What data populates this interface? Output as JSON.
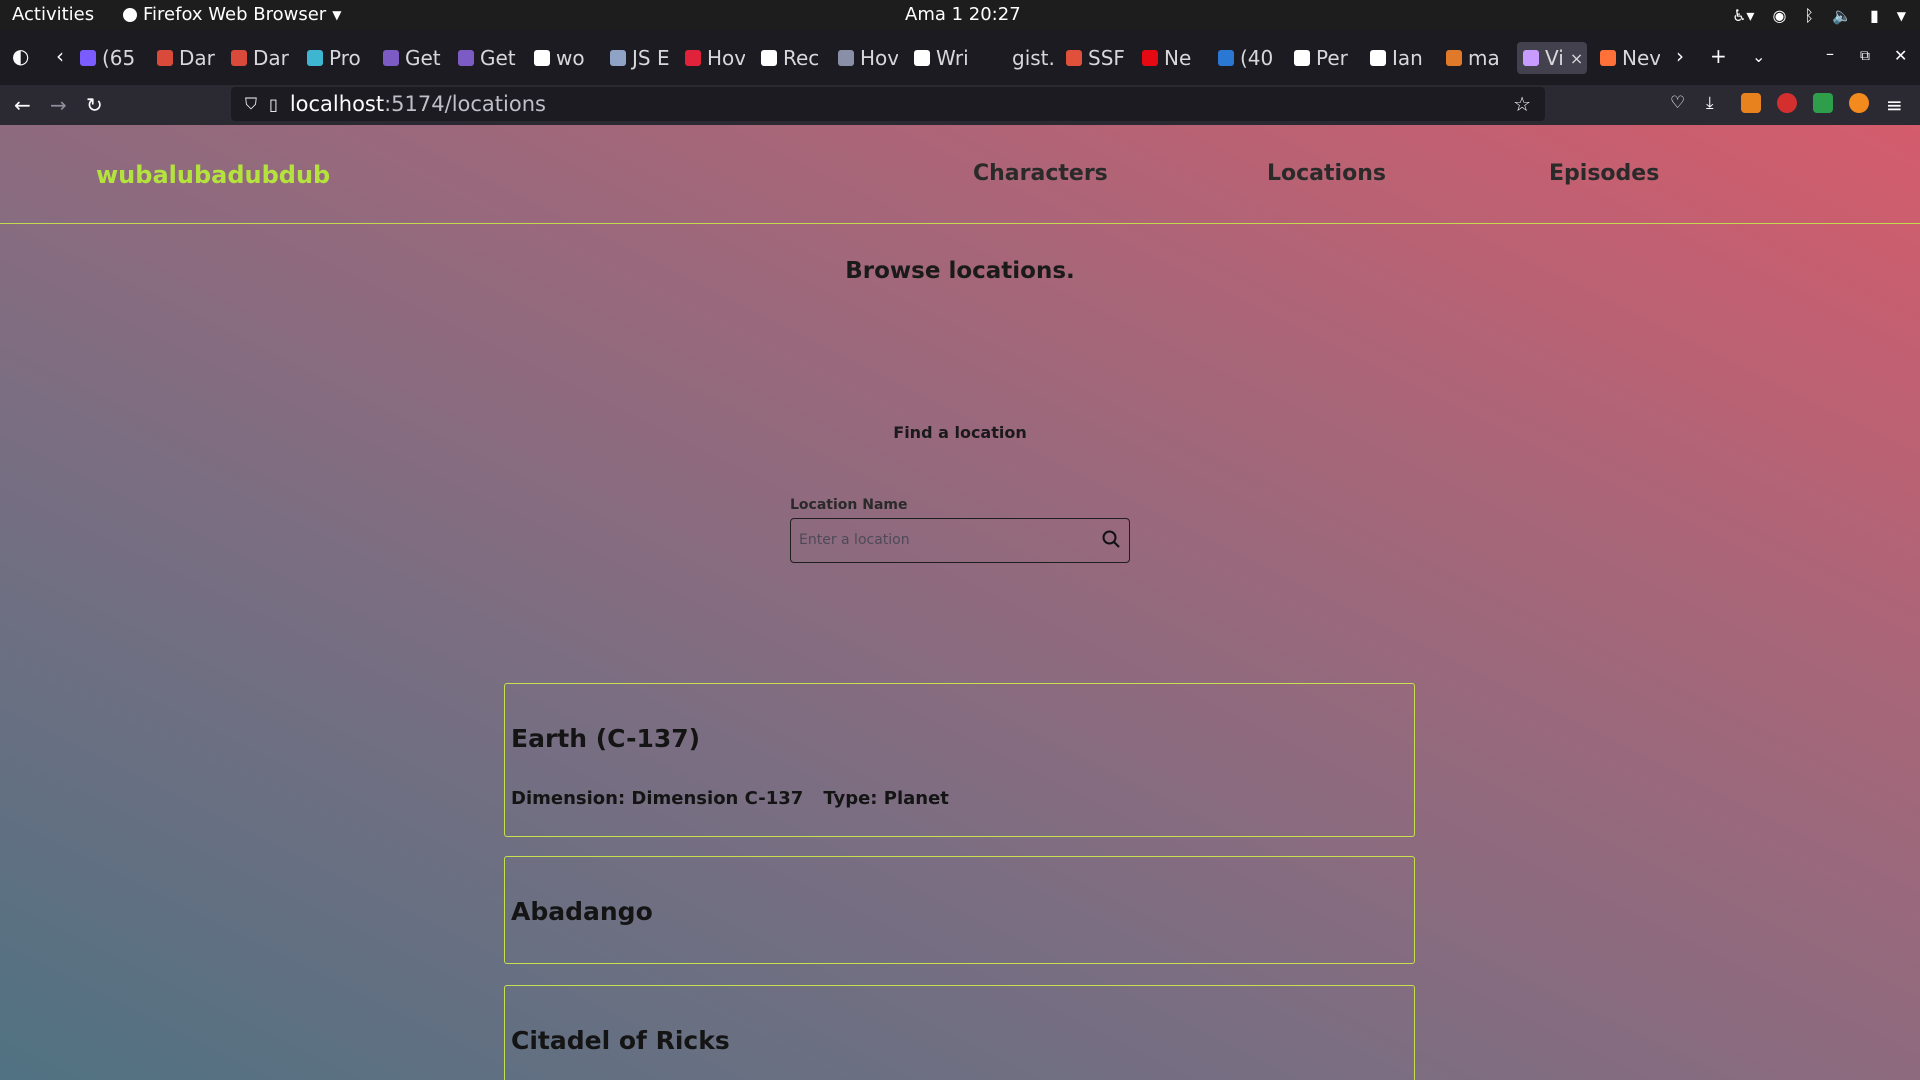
{
  "system": {
    "activities": "Activities",
    "app_menu": "Firefox Web Browser",
    "clock": "Ama 1  20:27"
  },
  "browser": {
    "tabs": [
      {
        "label": "(65",
        "color": "#7b5cff"
      },
      {
        "label": "Dar",
        "color": "#d94a3a"
      },
      {
        "label": "Dar",
        "color": "#d94a3a"
      },
      {
        "label": "Pro",
        "color": "#3fb6d1"
      },
      {
        "label": "Get",
        "color": "#7c5cc4"
      },
      {
        "label": "Get",
        "color": "#7c5cc4"
      },
      {
        "label": "wo",
        "color": "#ffffff"
      },
      {
        "label": "JS E",
        "color": "#8fa3c7"
      },
      {
        "label": "Hov",
        "color": "#e0223a"
      },
      {
        "label": "Rec",
        "color": "#ffffff"
      },
      {
        "label": "Hov",
        "color": "#8a8fa8"
      },
      {
        "label": "Wri",
        "color": "#ffffff"
      },
      {
        "label": "gist.g",
        "color": "#1c1b22"
      },
      {
        "label": "SSF",
        "color": "#e0503a"
      },
      {
        "label": "Ne",
        "color": "#e50914"
      },
      {
        "label": "(40",
        "color": "#2a77d4"
      },
      {
        "label": "Per",
        "color": "#ffffff"
      },
      {
        "label": "Ian",
        "color": "#ffffff"
      },
      {
        "label": "ma",
        "color": "#e07a2a"
      },
      {
        "label": "Vi",
        "color": "#c79bff"
      },
      {
        "label": "Nev",
        "color": "#ff7139"
      }
    ],
    "url_host": "localhost",
    "url_rest": ":5174/locations"
  },
  "site": {
    "logo": "wubalubadubdub",
    "nav": [
      "Characters",
      "Locations",
      "Episodes"
    ],
    "page_title": "Browse locations.",
    "find_title": "Find a location",
    "search": {
      "label": "Location Name",
      "placeholder": "Enter a location",
      "value": ""
    },
    "locations": [
      {
        "name": "Earth (C-137)",
        "dimension": "Dimension: Dimension C-137",
        "type": "Type: Planet"
      },
      {
        "name": "Abadango",
        "dimension": "",
        "type": ""
      },
      {
        "name": "Citadel of Ricks",
        "dimension": "",
        "type": ""
      }
    ]
  }
}
